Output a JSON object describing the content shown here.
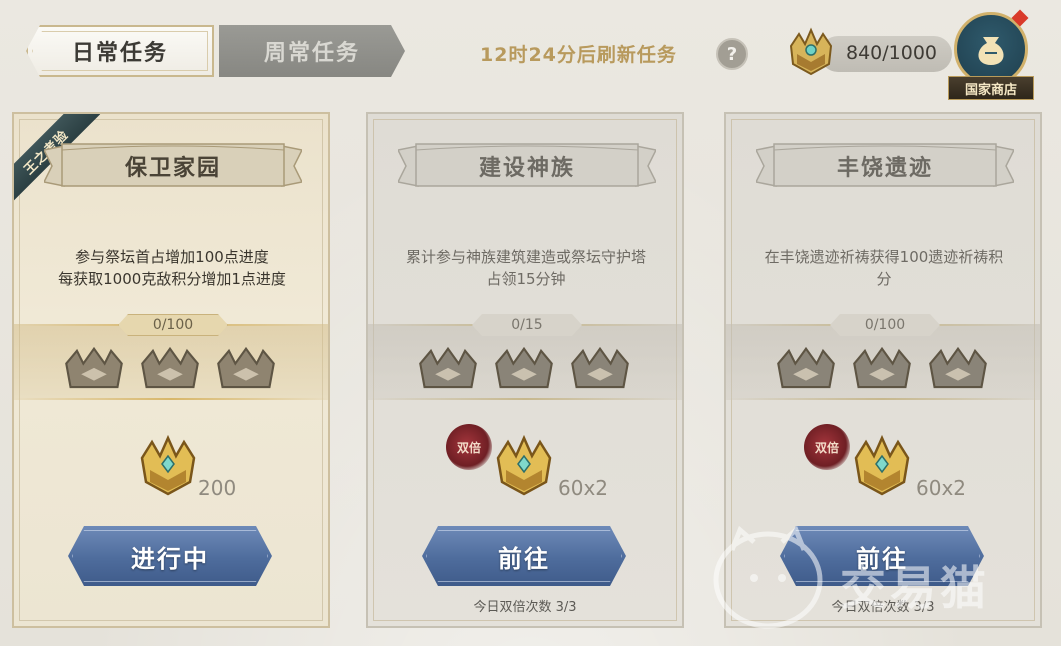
{
  "tabs": [
    {
      "label": "日常任务",
      "active": true
    },
    {
      "label": "周常任务",
      "active": false
    }
  ],
  "refresh_text": "12时24分后刷新任务",
  "help_label": "?",
  "currency": {
    "value": "840/1000",
    "icon": "crown-token-icon"
  },
  "shop": {
    "label": "国家商店",
    "icon": "money-bag-icon"
  },
  "cards": [
    {
      "ribbon": "王之考验",
      "title": "保卫家园",
      "desc_lines": [
        "参与祭坛首占增加100点进度",
        "每获取1000克敌积分增加1点进度"
      ],
      "progress": "0/100",
      "reward_value": "200",
      "double_badge": "",
      "button": "进行中",
      "double_count": ""
    },
    {
      "ribbon": "",
      "title": "建设神族",
      "desc_lines": [
        "累计参与神族建筑建造或祭坛守护塔",
        "占领15分钟"
      ],
      "progress": "0/15",
      "reward_value": "60x2",
      "double_badge": "双倍",
      "button": "前往",
      "double_count": "今日双倍次数 3/3"
    },
    {
      "ribbon": "",
      "title": "丰饶遗迹",
      "desc_lines": [
        "在丰饶遗迹祈祷获得100遗迹祈祷积",
        "分"
      ],
      "progress": "0/100",
      "reward_value": "60x2",
      "double_badge": "双倍",
      "button": "前往",
      "double_count": "今日双倍次数 3/3"
    }
  ],
  "watermark": "交易猫",
  "colors": {
    "accent_gold": "#b89a5d",
    "button_blue": "#4e6c9c",
    "badge_red": "#8a2a30"
  }
}
